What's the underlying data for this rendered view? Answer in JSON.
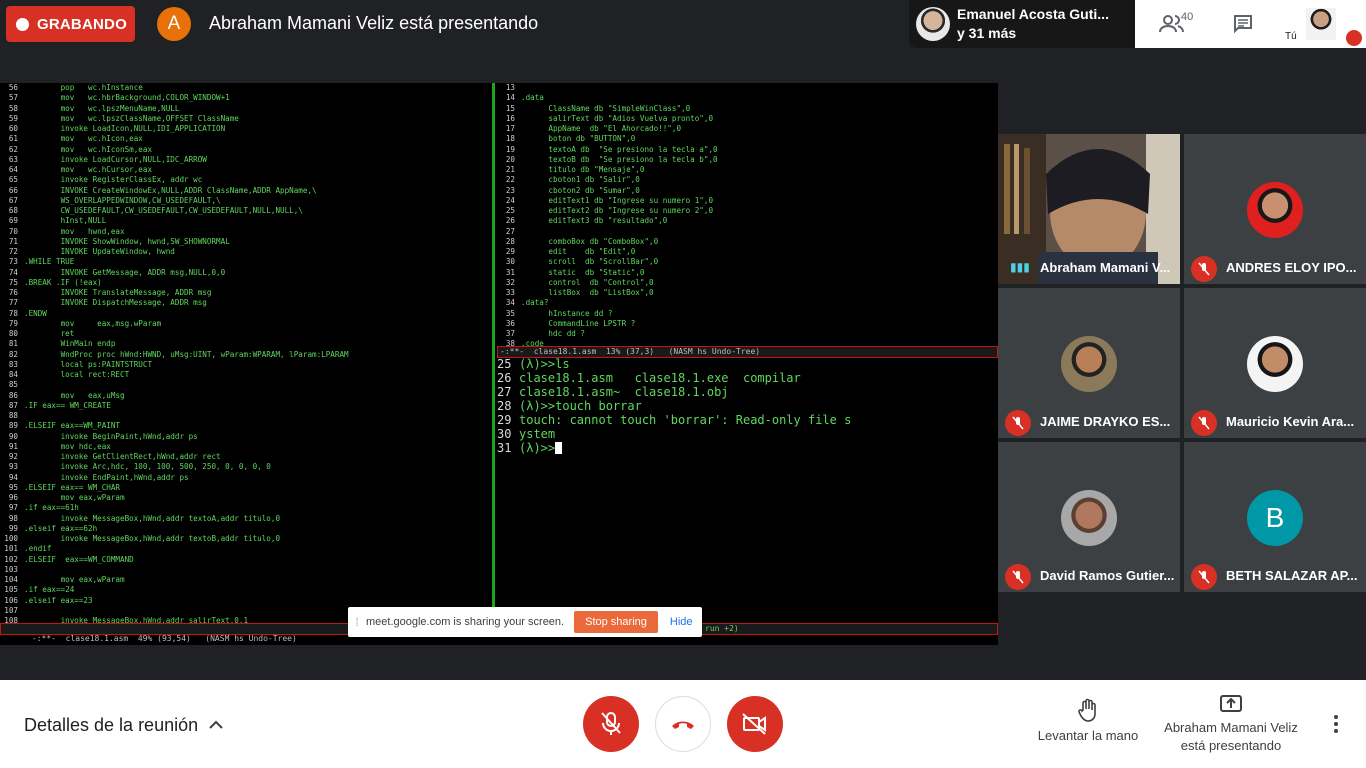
{
  "recording": {
    "label": "GRABANDO"
  },
  "presenter": {
    "initial": "A",
    "title": "Abraham Mamani Veliz está presentando"
  },
  "active_speaker": {
    "name": "Emanuel Acosta Guti...",
    "more": "y 31 más"
  },
  "toolbar": {
    "participant_count": "40",
    "self_label": "Tú"
  },
  "editor": {
    "left_lines": [
      [
        "56",
        "        pop   wc.hInstance"
      ],
      [
        "57",
        "        mov   wc.hbrBackground,COLOR_WINDOW+1"
      ],
      [
        "58",
        "        mov   wc.lpszMenuName,NULL"
      ],
      [
        "59",
        "        mov   wc.lpszClassName,OFFSET ClassName"
      ],
      [
        "60",
        "        invoke LoadIcon,NULL,IDI_APPLICATION"
      ],
      [
        "61",
        "        mov   wc.hIcon,eax"
      ],
      [
        "62",
        "        mov   wc.hIconSm,eax"
      ],
      [
        "63",
        "        invoke LoadCursor,NULL,IDC_ARROW"
      ],
      [
        "64",
        "        mov   wc.hCursor,eax"
      ],
      [
        "65",
        "        invoke RegisterClassEx, addr wc"
      ],
      [
        "66",
        "        INVOKE CreateWindowEx,NULL,ADDR ClassName,ADDR AppName,\\"
      ],
      [
        "67",
        "        WS_OVERLAPPEDWINDOW,CW_USEDEFAULT,\\"
      ],
      [
        "68",
        "        CW_USEDEFAULT,CW_USEDEFAULT,CW_USEDEFAULT,NULL,NULL,\\"
      ],
      [
        "69",
        "        hInst,NULL"
      ],
      [
        "70",
        "        mov   hwnd,eax"
      ],
      [
        "71",
        "        INVOKE ShowWindow, hwnd,SW_SHOWNORMAL"
      ],
      [
        "72",
        "        INVOKE UpdateWindow, hwnd"
      ],
      [
        "73",
        ".WHILE TRUE"
      ],
      [
        "74",
        "        INVOKE GetMessage, ADDR msg,NULL,0,0"
      ],
      [
        "75",
        ".BREAK .IF (!eax)"
      ],
      [
        "76",
        "        INVOKE TranslateMessage, ADDR msg"
      ],
      [
        "77",
        "        INVOKE DispatchMessage, ADDR msg"
      ],
      [
        "78",
        ".ENDW"
      ],
      [
        "79",
        "        mov     eax,msg.wParam"
      ],
      [
        "80",
        "        ret"
      ],
      [
        "81",
        "        WinMain endp"
      ],
      [
        "82",
        "        WndProc proc hWnd:HWND, uMsg:UINT, wParam:WPARAM, lParam:LPARAM"
      ],
      [
        "83",
        "        local ps:PAINTSTRUCT"
      ],
      [
        "84",
        "        local rect:RECT"
      ],
      [
        "85",
        ""
      ],
      [
        "86",
        "        mov   eax,uMsg"
      ],
      [
        "87",
        ".IF eax== WM_CREATE"
      ],
      [
        "88",
        ""
      ],
      [
        "89",
        ".ELSEIF eax==WM_PAINT"
      ],
      [
        "90",
        "        invoke BeginPaint,hWnd,addr ps"
      ],
      [
        "91",
        "        mov hdc,eax"
      ],
      [
        "92",
        "        invoke GetClientRect,hWnd,addr rect"
      ],
      [
        "93",
        "        invoke Arc,hdc, 100, 100, 500, 250, 0, 0, 0, 0"
      ],
      [
        "94",
        "        invoke EndPaint,hWnd,addr ps"
      ],
      [
        "95",
        ".ELSEIF eax== WM_CHAR"
      ],
      [
        "96",
        "        mov eax,wParam"
      ],
      [
        "97",
        ".if eax==61h"
      ],
      [
        "98",
        "        invoke MessageBox,hWnd,addr textoA,addr titulo,0"
      ],
      [
        "99",
        ".elseif eax==62h"
      ],
      [
        "100",
        "        invoke MessageBox,hWnd,addr textoB,addr titulo,0"
      ],
      [
        "101",
        ".endif"
      ],
      [
        "102",
        ".ELSEIF  eax==WM_COMMAND"
      ],
      [
        "103",
        ""
      ],
      [
        "104",
        "        mov eax,wParam"
      ],
      [
        "105",
        ".if eax==24"
      ],
      [
        "106",
        ".elseif eax==23"
      ],
      [
        "107",
        ""
      ],
      [
        "108",
        "        invoke MessageBox,hWnd,addr salirText,0,1"
      ]
    ],
    "right_lines": [
      [
        "13",
        ""
      ],
      [
        "14",
        ".data"
      ],
      [
        "15",
        "      ClassName db \"SimpleWinClass\",0"
      ],
      [
        "16",
        "      salirText db \"Adios Vuelva pronto\",0"
      ],
      [
        "17",
        "      AppName  db \"El Ahorcado!!\",0"
      ],
      [
        "18",
        "      boton db \"BUTTON\",0"
      ],
      [
        "19",
        "      textoA db  \"Se presiono la tecla a\",0"
      ],
      [
        "20",
        "      textoB db  \"Se presiono la tecla b\",0"
      ],
      [
        "21",
        "      titulo db \"Mensaje\",0"
      ],
      [
        "22",
        "      cboton1 db \"Salir\",0"
      ],
      [
        "23",
        "      cboton2 db \"Sumar\",0"
      ],
      [
        "24",
        "      editText1 db \"Ingrese su numero 1\",0"
      ],
      [
        "25",
        "      editText2 db \"Ingrese su numero 2\",0"
      ],
      [
        "26",
        "      editText3 db \"resultado\",0"
      ],
      [
        "27",
        ""
      ],
      [
        "28",
        "      comboBox db \"ComboBox\",0"
      ],
      [
        "29",
        "      edit    db \"Edit\",0"
      ],
      [
        "30",
        "      scroll  db \"ScrollBar\",0"
      ],
      [
        "31",
        "      static  db \"Static\",0"
      ],
      [
        "32",
        "      control  db \"Control\",0"
      ],
      [
        "33",
        "      listBox  db \"ListBox\",0"
      ],
      [
        "34",
        ".data?"
      ],
      [
        "35",
        "      hInstance dd ?"
      ],
      [
        "36",
        "      CommandLine LPSTR ?"
      ],
      [
        "37",
        "      hdc dd ?"
      ],
      [
        "38",
        ".code"
      ]
    ],
    "modeline_right": "-:**-  clase18.1.asm  13% (37,3)   (NASM hs Undo-Tree)",
    "modeline_left": "-:**-  clase18.1.asm  49% (93,54)   (NASM hs Undo-Tree)",
    "modeline_left_tail": "run +2)"
  },
  "terminal": {
    "lines": [
      [
        "25",
        "(λ)>>ls"
      ],
      [
        "26",
        "clase18.1.asm   clase18.1.exe  compilar"
      ],
      [
        "27",
        "clase18.1.asm~  clase18.1.obj"
      ],
      [
        "28",
        "(λ)>>touch borrar"
      ],
      [
        "29",
        "touch: cannot touch 'borrar': Read-only file s"
      ],
      [
        "30",
        "ystem"
      ],
      [
        "31",
        "(λ)>>"
      ]
    ]
  },
  "share_bar": {
    "message": "meet.google.com is sharing your screen.",
    "stop": "Stop sharing",
    "hide": "Hide"
  },
  "participants": [
    {
      "name": "Abraham Mamani V...",
      "type": "camera"
    },
    {
      "name": "ANDRES ELOY IPO...",
      "type": "avatar"
    },
    {
      "name": "JAIME DRAYKO ES...",
      "type": "avatar"
    },
    {
      "name": "Mauricio Kevin Ara...",
      "type": "avatar"
    },
    {
      "name": "David Ramos Gutier...",
      "type": "avatar"
    },
    {
      "name": "BETH SALAZAR AP...",
      "type": "initial",
      "initial": "B",
      "color": "#0097a7"
    }
  ],
  "bottom": {
    "details": "Detalles de la reunión",
    "raise_hand": "Levantar la mano",
    "presenting_line1": "Abraham Mamani Veliz",
    "presenting_line2": "está presentando"
  },
  "colors": {
    "record_red": "#d93025",
    "terminal_green": "#5fd75f",
    "stop_orange": "#ea6a3c"
  }
}
